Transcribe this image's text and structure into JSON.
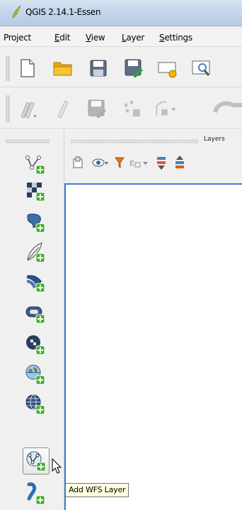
{
  "window": {
    "title": "QGIS 2.14.1-Essen",
    "icon": "qgis-logo-icon"
  },
  "menubar": {
    "items": [
      {
        "label": "Project",
        "underline": ""
      },
      {
        "label": "Edit",
        "underline": "E"
      },
      {
        "label": "View",
        "underline": "V"
      },
      {
        "label": "Layer",
        "underline": "L"
      },
      {
        "label": "Settings",
        "underline": "S"
      }
    ]
  },
  "file_toolbar": {
    "buttons": [
      "new-project-icon",
      "open-project-icon",
      "save-project-icon",
      "save-as-icon",
      "new-print-composer-icon",
      "composer-manager-icon"
    ]
  },
  "digitize_toolbar": {
    "buttons": [
      "current-edits-icon",
      "toggle-editing-icon",
      "save-edits-icon",
      "add-feature-icon",
      "move-feature-icon",
      "node-tool-icon"
    ]
  },
  "layers_panel": {
    "title": "Layers",
    "toolbar_icons": [
      "add-group-icon",
      "manage-visibility-icon",
      "filter-legend-icon",
      "filter-expression-icon",
      "expand-all-icon",
      "collapse-all-icon"
    ]
  },
  "manage_layers_toolbar": {
    "buttons": [
      "add-vector-layer-icon",
      "add-raster-layer-icon",
      "add-postgis-layer-icon",
      "add-spatialite-layer-icon",
      "add-mssql-layer-icon",
      "add-oracle-layer-icon",
      "add-db2-layer-icon",
      "add-wms-layer-icon",
      "add-wcs-layer-icon",
      "add-wfs-layer-icon",
      "add-delimited-text-layer-icon"
    ],
    "active": "add-wfs-layer-icon"
  },
  "tooltip": {
    "text": "Add WFS Layer"
  },
  "colors": {
    "accent": "#3b7fd4",
    "plus": "#3fae2a",
    "tooltip_bg": "#ffffe1"
  }
}
